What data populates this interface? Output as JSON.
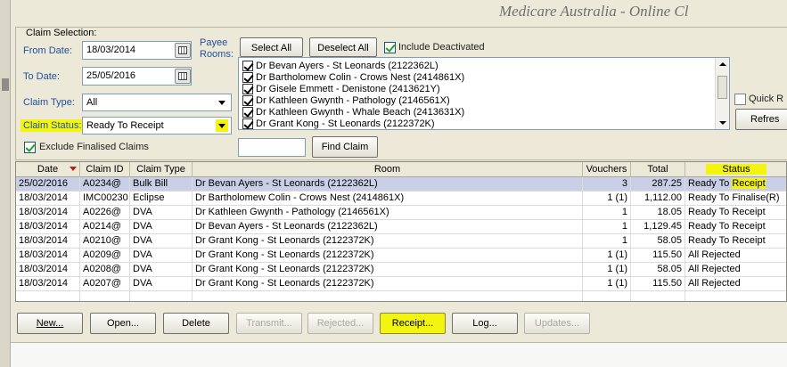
{
  "banner": "Medicare Australia - Online Cl",
  "claim_selection": {
    "legend": "Claim Selection:",
    "from_date_label": "From Date:",
    "from_date_value": "18/03/2014",
    "to_date_label": "To Date:",
    "to_date_value": "25/05/2016",
    "claim_type_label": "Claim Type:",
    "claim_type_value": "All",
    "claim_status_label": "Claim Status:",
    "claim_status_value": "Ready To Receipt",
    "exclude_finalised_label": "Exclude Finalised Claims",
    "exclude_finalised_checked": true,
    "payee_label_line1": "Payee",
    "payee_label_line2": "Rooms:",
    "select_all_label": "Select All",
    "deselect_all_label": "Deselect All",
    "include_deactivated_label": "Include Deactivated",
    "include_deactivated_checked": true,
    "find_claim_input_value": "",
    "find_claim_label": "Find Claim",
    "quick_label": "Quick R",
    "refresh_label": "Refres"
  },
  "payees": [
    {
      "label": "Dr Bevan Ayers - St Leonards (2122362L)",
      "checked": true
    },
    {
      "label": "Dr Bartholomew Colin - Crows Nest (2414861X)",
      "checked": true
    },
    {
      "label": "Dr Gisele Emmett - Denistone (2413621Y)",
      "checked": true
    },
    {
      "label": "Dr Kathleen Gwynth - Pathology (2146561X)",
      "checked": true
    },
    {
      "label": "Dr Kathleen Gwynth - Whale Beach (2413631X)",
      "checked": true
    },
    {
      "label": "Dr Grant Kong - St Leonards (2122372K)",
      "checked": true
    }
  ],
  "grid": {
    "columns": [
      "Date",
      "Claim ID",
      "Claim Type",
      "Room",
      "Vouchers",
      "Total",
      "Status"
    ],
    "rows": [
      {
        "date": "25/02/2016",
        "claim_id": "A0234@",
        "claim_type": "Bulk Bill",
        "room": "Dr Bevan Ayers - St Leonards (2122362L)",
        "vouchers": "3",
        "total": "287.25",
        "status_prefix": "Ready To ",
        "status_hl": "Receipt",
        "selected": true
      },
      {
        "date": "18/03/2014",
        "claim_id": "IMC00230",
        "claim_type": "Eclipse",
        "room": "Dr Bartholomew Colin - Crows Nest (2414861X)",
        "vouchers": "1 (1)",
        "total": "1,112.00",
        "status_prefix": "Ready To Finalise(R)",
        "status_hl": "",
        "selected": false
      },
      {
        "date": "18/03/2014",
        "claim_id": "A0226@",
        "claim_type": "DVA",
        "room": "Dr Kathleen Gwynth - Pathology (2146561X)",
        "vouchers": "1",
        "total": "18.05",
        "status_prefix": "Ready To Receipt",
        "status_hl": "",
        "selected": false
      },
      {
        "date": "18/03/2014",
        "claim_id": "A0214@",
        "claim_type": "DVA",
        "room": "Dr Bevan Ayers - St Leonards (2122362L)",
        "vouchers": "1",
        "total": "1,129.45",
        "status_prefix": "Ready To Receipt",
        "status_hl": "",
        "selected": false
      },
      {
        "date": "18/03/2014",
        "claim_id": "A0210@",
        "claim_type": "DVA",
        "room": "Dr Grant Kong - St Leonards (2122372K)",
        "vouchers": "1",
        "total": "58.05",
        "status_prefix": "Ready To Receipt",
        "status_hl": "",
        "selected": false
      },
      {
        "date": "18/03/2014",
        "claim_id": "A0209@",
        "claim_type": "DVA",
        "room": "Dr Grant Kong - St Leonards (2122372K)",
        "vouchers": "1 (1)",
        "total": "115.50",
        "status_prefix": "All Rejected",
        "status_hl": "",
        "selected": false
      },
      {
        "date": "18/03/2014",
        "claim_id": "A0208@",
        "claim_type": "DVA",
        "room": "Dr Grant Kong - St Leonards (2122372K)",
        "vouchers": "1 (1)",
        "total": "58.05",
        "status_prefix": "All Rejected",
        "status_hl": "",
        "selected": false
      },
      {
        "date": "18/03/2014",
        "claim_id": "A0207@",
        "claim_type": "DVA",
        "room": "Dr Grant Kong - St Leonards (2122372K)",
        "vouchers": "1 (1)",
        "total": "115.50",
        "status_prefix": "All Rejected",
        "status_hl": "",
        "selected": false
      }
    ]
  },
  "buttons": {
    "new": "New...",
    "open": "Open...",
    "delete": "Delete",
    "transmit": "Transmit...",
    "rejected": "Rejected...",
    "receipt": "Receipt...",
    "log": "Log...",
    "updates": "Updates..."
  },
  "colors": {
    "highlight": "#f4f411",
    "selected_row": "#c9cfe6",
    "label_blue": "#1f4f9c"
  }
}
